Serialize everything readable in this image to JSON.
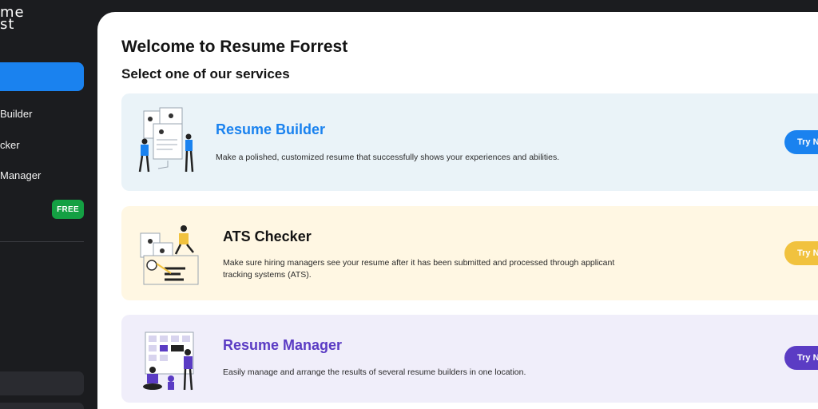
{
  "sidebar": {
    "logo_line1": "me",
    "logo_line2": "st",
    "items": [
      {
        "label": "Builder"
      },
      {
        "label": "cker"
      },
      {
        "label": "Manager"
      }
    ],
    "free_badge": "FREE"
  },
  "main": {
    "title": "Welcome to Resume Forrest",
    "subtitle": "Select one of our services"
  },
  "services": [
    {
      "title": "Resume Builder",
      "description": "Make a polished, customized resume that successfully shows your experiences and abilities.",
      "button": "Try N",
      "color": "#1a82ef"
    },
    {
      "title": "ATS Checker",
      "description": "Make sure hiring managers see your resume after it has been submitted and processed through applicant tracking systems (ATS).",
      "button": "Try N",
      "color": "#f1c23e"
    },
    {
      "title": "Resume Manager",
      "description": "Easily manage and arrange the results of several resume builders in one location.",
      "button": "Try N",
      "color": "#5b3cc4"
    }
  ]
}
